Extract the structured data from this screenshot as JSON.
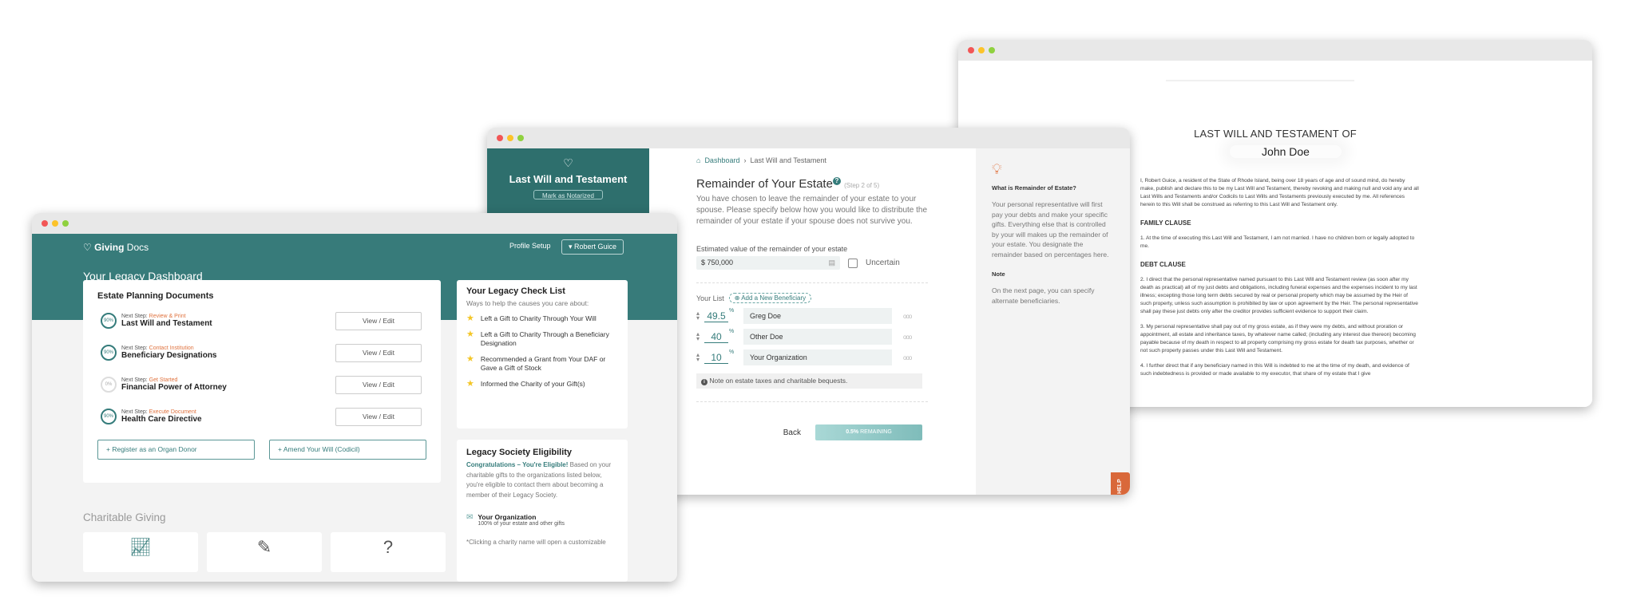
{
  "document_window": {
    "heading": "LAST WILL AND TESTAMENT OF",
    "name": "John Doe",
    "intro": "I, Robert Guice, a resident of the State of Rhode Island, being over 18 years of age and of sound mind, do hereby make, publish and declare this to be my Last Will and Testament, thereby revoking and making null and void any and all Last Wills and Testaments and/or Codicils to Last Wills and Testaments previously executed by me. All references herein to this Will shall be construed as referring to this Last Will and Testament only.",
    "family_heading": "FAMILY CLAUSE",
    "clause1": "1.      At the time of executing this Last Will and Testament, I am not married. I have no children born or legally adopted to me.",
    "debt_heading": "DEBT CLAUSE",
    "clause2": "2.      I direct that the personal representative named pursuant to this Last Will and Testament review (as soon after my death as practical) all of my just debts and obligations, including funeral expenses and the expenses incident to my last illness; excepting those long term debts secured by real or personal property which may be assumed by the Heir of such property, unless such assumption is prohibited by law or upon agreement by the Heir. The personal representative shall pay these just debts only after the creditor provides sufficient evidence to support their claim.",
    "clause3": "3.      My personal representative shall pay out of my gross estate, as if they were my debts, and without proration or appointment, all estate and inheritance taxes, by whatever name called; (including any interest due thereon) becoming payable because of my death in respect to all property comprising my gross estate for death tax purposes, whether or not such property passes under this Last Will and Testament.",
    "clause4": "4.      I further direct that if any beneficiary named in this Will is indebted to me at the time of my death, and evidence of such indebtedness is provided or made available to my executor, that share of my estate that I give"
  },
  "wizard_window": {
    "sidebar_title": "Last Will and Testament",
    "sidebar_button": "Mark as Notarized",
    "breadcrumb": {
      "home": "Dashboard",
      "current": "Last Will and Testament"
    },
    "title": "Remainder of Your Estate",
    "step": "(Step 2 of 5)",
    "description": "You have chosen to leave the remainder of your estate to your spouse. Please specify below how you would like to distribute the remainder of your estate if your spouse does not survive you.",
    "estimate_label": "Estimated value of the remainder of your estate",
    "estimate_value": "$ 750,000",
    "uncertain_label": "Uncertain",
    "list_label": "Your List",
    "add_beneficiary": "Add a New Beneficiary",
    "beneficiaries": [
      {
        "percent": "49.5",
        "name": "Greg Doe"
      },
      {
        "percent": "40",
        "name": "Other Doe"
      },
      {
        "percent": "10",
        "name": "Your Organization"
      }
    ],
    "percent_symbol": "%",
    "note": "Note on estate taxes and charitable bequests.",
    "back_label": "Back",
    "remaining_value": "0.5%",
    "remaining_label": "REMAINING",
    "help": {
      "title": "What is Remainder of Estate?",
      "body": "Your personal representative will first pay your debts and make your specific gifts. Everything else that is controlled by your will makes up the remainder of your estate. You designate the remainder based on percentages here.",
      "note_title": "Note",
      "note_body": "On the next page, you can specify alternate beneficiaries.",
      "tab": "HELP"
    }
  },
  "dashboard_window": {
    "brand_bold": "Giving",
    "brand_light": " Docs",
    "profile_setup": "Profile Setup",
    "user": "Robert Guice",
    "page_title": "Your Legacy Dashboard",
    "documents_title": "Estate Planning Documents",
    "next_step_prefix": "Next Step: ",
    "documents": [
      {
        "progress": "90%",
        "next_step": "Review & Print",
        "name": "Last Will and Testament",
        "action": "View / Edit"
      },
      {
        "progress": "90%",
        "next_step": "Contact Institution",
        "name": "Beneficiary Designations",
        "action": "View / Edit"
      },
      {
        "progress": "0%",
        "next_step": "Get Started",
        "name": "Financial Power of Attorney",
        "action": "View / Edit"
      },
      {
        "progress": "90%",
        "next_step": "Execute Document",
        "name": "Health Care Directive",
        "action": "View / Edit"
      }
    ],
    "organ_donor": "Register as an Organ Donor",
    "amend_will": "Amend Your Will (Codicil)",
    "checklist_title": "Your Legacy Check List",
    "checklist_sub": "Ways to help the causes you care about:",
    "checklist": [
      "Left a Gift to Charity Through Your Will",
      "Left a Gift to Charity Through a Beneficiary Designation",
      "Recommended a Grant from Your DAF or Gave a Gift of Stock",
      "Informed the Charity of your Gift(s)"
    ],
    "society_title": "Legacy Society Eligibility",
    "society_congrats": "Congratulations – You're Eligible!",
    "society_body": " Based on your charitable gifts to the organizations listed below, you're eligible to contact them about becoming a member of their Legacy Society.",
    "org_name": "Your Organization",
    "org_detail": "100% of your estate and other gifts",
    "society_footnote": "*Clicking a charity name will open a customizable",
    "charitable_title": "Charitable Giving"
  }
}
